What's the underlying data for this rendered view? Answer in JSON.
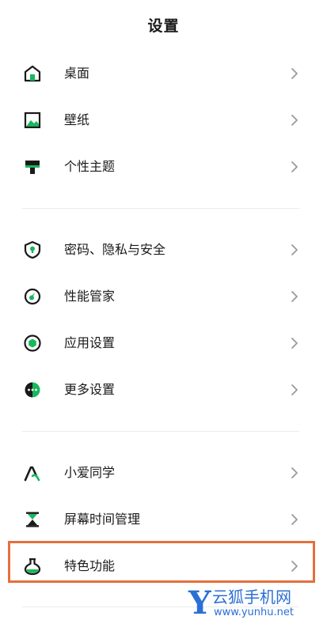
{
  "header": {
    "title": "设置"
  },
  "accent_color": "#18b85c",
  "highlight_color": "#e4703e",
  "groups": [
    {
      "items": [
        {
          "label": "桌面",
          "icon": "home-icon"
        },
        {
          "label": "壁纸",
          "icon": "wallpaper-icon"
        },
        {
          "label": "个性主题",
          "icon": "theme-icon"
        }
      ]
    },
    {
      "items": [
        {
          "label": "密码、隐私与安全",
          "icon": "shield-icon"
        },
        {
          "label": "性能管家",
          "icon": "performance-icon"
        },
        {
          "label": "应用设置",
          "icon": "app-settings-icon"
        },
        {
          "label": "更多设置",
          "icon": "more-icon"
        }
      ]
    },
    {
      "items": [
        {
          "label": "小爱同学",
          "icon": "xiaoai-icon"
        },
        {
          "label": "屏幕时间管理",
          "icon": "hourglass-icon"
        },
        {
          "label": "特色功能",
          "icon": "flask-icon",
          "highlighted": true
        }
      ]
    }
  ],
  "watermark": {
    "logo": "Y",
    "name": "云狐手机网",
    "url": "www.yunhu.net"
  }
}
